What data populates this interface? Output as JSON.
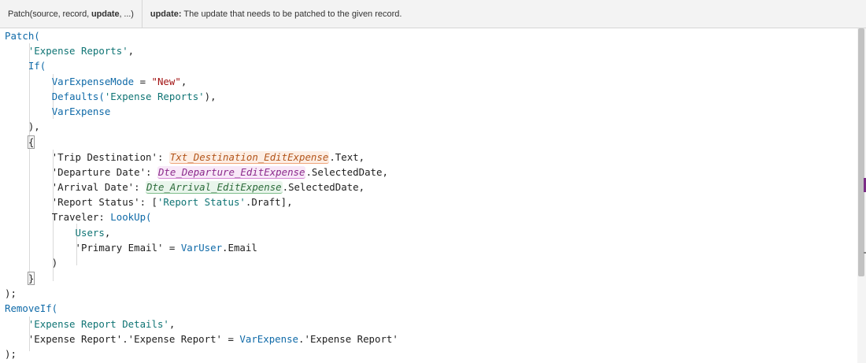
{
  "signature_help": {
    "function_prefix": "Patch(source, record, ",
    "active_param": "update",
    "function_suffix": ", ...)",
    "param_name": "update:",
    "param_description": " The update that needs to be patched to the given record."
  },
  "code": {
    "l1_fn": "Patch(",
    "l2_str": "'Expense Reports'",
    "l2_punct": ",",
    "l3_fn": "If(",
    "l4_ident": "VarExpenseMode",
    "l4_op": " = ",
    "l4_str": "\"New\"",
    "l4_punct": ",",
    "l5_fn": "Defaults(",
    "l5_str": "'Expense Reports'",
    "l5_punct": "),",
    "l6_ident": "VarExpense",
    "l7": "),",
    "l8_brace": "{",
    "l9_key": "'Trip Destination': ",
    "l9_ctl": "Txt_Destination_EditExpense",
    "l9_prop": ".Text,",
    "l10_key": "'Departure Date': ",
    "l10_ctl": "Dte_Departure_EditExpense",
    "l10_prop": ".SelectedDate,",
    "l11_key": "'Arrival Date': ",
    "l11_ctl": "Dte_Arrival_EditExpense",
    "l11_prop": ".SelectedDate,",
    "l12_key": "'Report Status': [",
    "l12_str": "'Report Status'",
    "l12_rest": ".Draft],",
    "l13_key": "Traveler: ",
    "l13_fn": "LookUp(",
    "l14_ident": "Users",
    "l14_punct": ",",
    "l15_key": "'Primary Email'",
    "l15_op": " = ",
    "l15_ident": "VarUser",
    "l15_rest": ".Email",
    "l16": ")",
    "l17_brace": "}",
    "l18": ");",
    "l19_fn": "RemoveIf(",
    "l20_str": "'Expense Report Details'",
    "l20_punct": ",",
    "l21_key": "'Expense Report'.'Expense Report'",
    "l21_op": " = ",
    "l21_ident": "VarExpense",
    "l21_rest": ".'Expense Report'",
    "l22": ");"
  },
  "colors": {
    "string": "#0f7474",
    "function": "#0f6aa8",
    "string_literal": "#a31515",
    "control_orange": "#b3551a",
    "control_purple": "#8b2a8b",
    "control_green": "#2c6b3a"
  }
}
